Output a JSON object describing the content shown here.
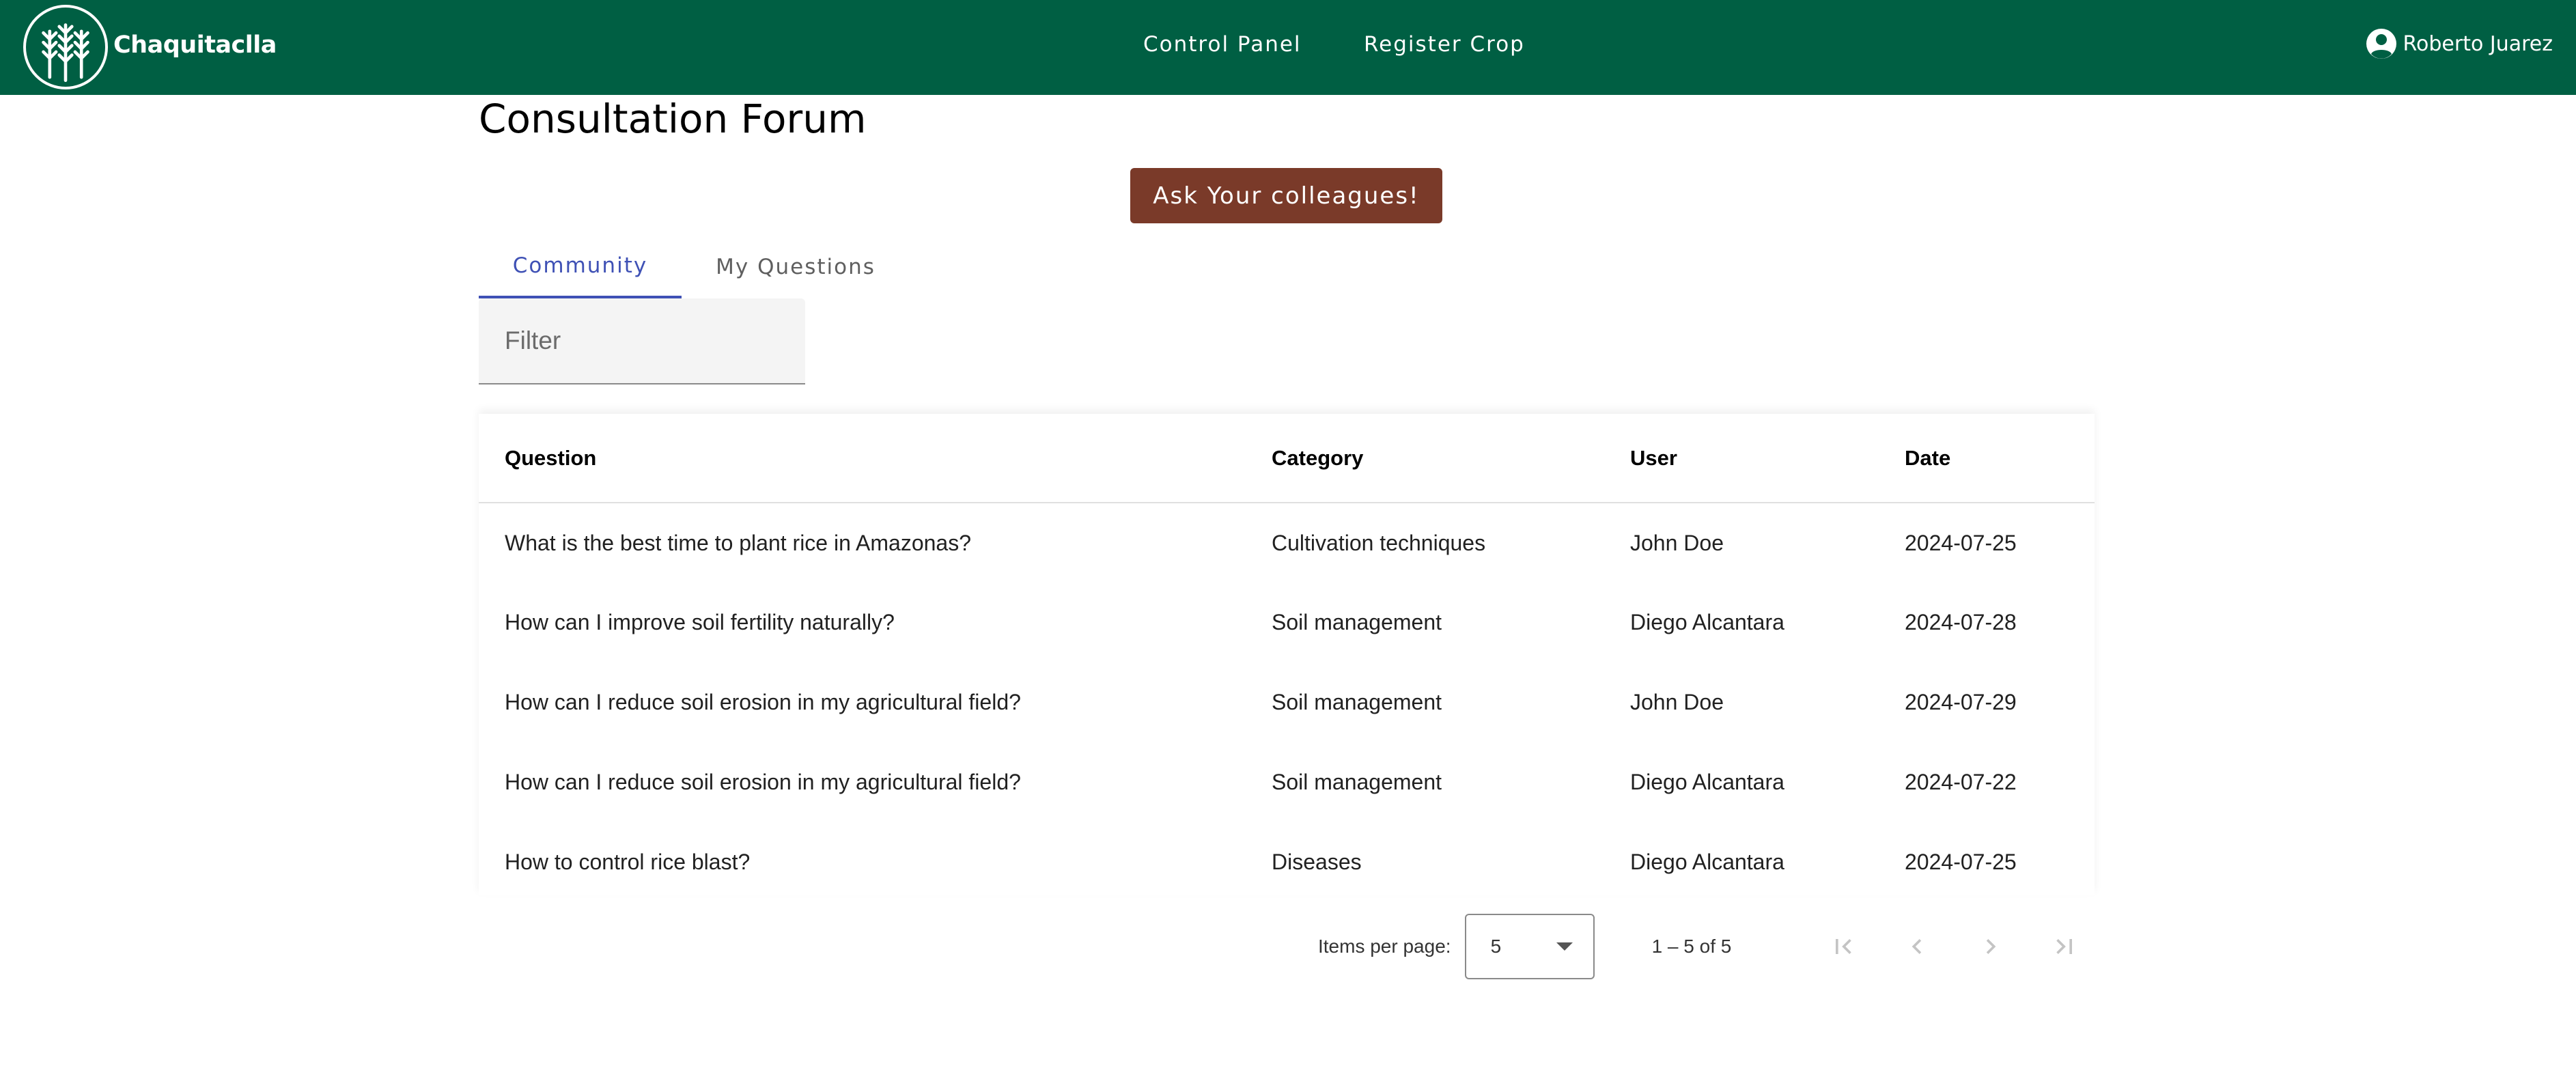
{
  "header": {
    "brand": "Chaquitaclla",
    "nav": [
      "Control Panel",
      "Register Crop"
    ],
    "user_name": "Roberto Juarez"
  },
  "main": {
    "title": "Consultation Forum",
    "ask_button": "Ask Your colleagues!",
    "tabs": [
      {
        "label": "Community",
        "active": true
      },
      {
        "label": "My Questions",
        "active": false
      }
    ],
    "filter_placeholder": "Filter",
    "table": {
      "columns": [
        "Question",
        "Category",
        "User",
        "Date"
      ],
      "rows": [
        {
          "question": "What is the best time to plant rice in Amazonas?",
          "category": "Cultivation techniques",
          "user": "John Doe",
          "date": "2024-07-25"
        },
        {
          "question": "How can I improve soil fertility naturally?",
          "category": "Soil management",
          "user": "Diego Alcantara",
          "date": "2024-07-28"
        },
        {
          "question": "How can I reduce soil erosion in my agricultural field?",
          "category": "Soil management",
          "user": "John Doe",
          "date": "2024-07-29"
        },
        {
          "question": "How can I reduce soil erosion in my agricultural field?",
          "category": "Soil management",
          "user": "Diego Alcantara",
          "date": "2024-07-22"
        },
        {
          "question": "How to control rice blast?",
          "category": "Diseases",
          "user": "Diego Alcantara",
          "date": "2024-07-25"
        }
      ]
    },
    "paginator": {
      "items_per_page_label": "Items per page:",
      "items_per_page": "5",
      "range": "1 – 5 of 5"
    }
  },
  "colors": {
    "header_bg": "#005f43",
    "ask_button_bg": "#7a3a29",
    "active_tab": "#3f51b5"
  },
  "icons": [
    "wheat-logo-icon",
    "account-circle-icon",
    "chevron-down-icon",
    "first-page-icon",
    "prev-page-icon",
    "next-page-icon",
    "last-page-icon"
  ]
}
